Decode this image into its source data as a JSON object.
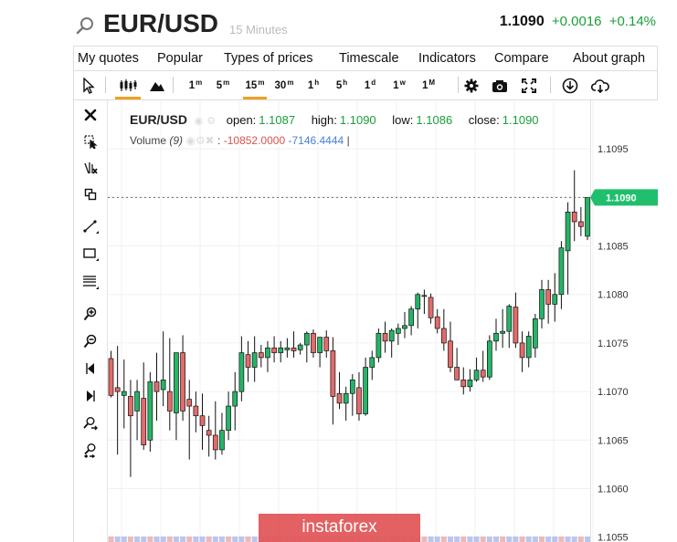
{
  "header": {
    "symbol": "EUR/USD",
    "interval": "15 Minutes",
    "last_price": "1.1090",
    "change": "+0.0016",
    "change_pct": "+0.14%"
  },
  "menu": [
    "My quotes",
    "Popular",
    "Types of prices",
    "Timescale",
    "Indicators",
    "Compare",
    "About graph"
  ],
  "timeframes": [
    {
      "base": "1",
      "sup": "m"
    },
    {
      "base": "5",
      "sup": "m"
    },
    {
      "base": "15",
      "sup": "m",
      "active": true
    },
    {
      "base": "30",
      "sup": "m"
    },
    {
      "base": "1",
      "sup": "h"
    },
    {
      "base": "5",
      "sup": "h"
    },
    {
      "base": "1",
      "sup": "d"
    },
    {
      "base": "1",
      "sup": "w"
    },
    {
      "base": "1",
      "sup": "M"
    }
  ],
  "toolbar_icons": [
    "cursor-icon",
    "candlestick-icon",
    "area-chart-icon",
    "gear-icon",
    "camera-icon",
    "fullscreen-icon",
    "download-icon",
    "cloud-download-icon"
  ],
  "left_tools": [
    "close-icon",
    "select-tool-icon",
    "delete-drawings-icon",
    "layers-icon",
    "trendline-icon",
    "rectangle-icon",
    "fib-levels-icon",
    "zoom-in-icon",
    "zoom-out-icon",
    "scroll-left-icon",
    "scroll-right-icon",
    "zoom-fit-icon",
    "zoom-reset-icon"
  ],
  "legend": {
    "symbol": "EUR/USD",
    "open_label": "open:",
    "open": "1.1087",
    "high_label": "high:",
    "high": "1.1090",
    "low_label": "low:",
    "low": "1.1086",
    "close_label": "close:",
    "close": "1.1090"
  },
  "volume_legend": {
    "label": "Volume",
    "period": "(9)",
    "value1": "-10852.0000",
    "value2": "-7146.4444",
    "sep": ":",
    "end": "|"
  },
  "colors": {
    "up": "#26b467",
    "down": "#e36b6b",
    "price_tag": "#1fbf6d"
  },
  "watermark": "instaforex",
  "chart_data": {
    "type": "candlestick",
    "price_tag": "1.1090",
    "yticks": [
      "1.1095",
      "1.1090",
      "1.1085",
      "1.1080",
      "1.1075",
      "1.1070",
      "1.1065",
      "1.1060",
      "1.1055"
    ],
    "ylim": [
      1.10545,
      1.11
    ],
    "candles": [
      [
        1.10734,
        1.10742,
        1.10694,
        1.10696
      ],
      [
        1.10704,
        1.10747,
        1.10635,
        1.107
      ],
      [
        1.10696,
        1.10733,
        1.10662,
        1.107
      ],
      [
        1.10695,
        1.10712,
        1.10612,
        1.10675
      ],
      [
        1.1068,
        1.10712,
        1.1065,
        1.107
      ],
      [
        1.10693,
        1.1073,
        1.1064,
        1.10645
      ],
      [
        1.1065,
        1.1072,
        1.10638,
        1.1071
      ],
      [
        1.1071,
        1.1074,
        1.1067,
        1.107
      ],
      [
        1.10702,
        1.10762,
        1.10685,
        1.10712
      ],
      [
        1.107,
        1.10755,
        1.1066,
        1.1068
      ],
      [
        1.10678,
        1.10715,
        1.1065,
        1.1074
      ],
      [
        1.1074,
        1.10758,
        1.1067,
        1.1068
      ],
      [
        1.10692,
        1.10712,
        1.1063,
        1.10685
      ],
      [
        1.10685,
        1.107,
        1.10658,
        1.10675
      ],
      [
        1.10675,
        1.10698,
        1.1064,
        1.10665
      ],
      [
        1.1066,
        1.10675,
        1.10633,
        1.10655
      ],
      [
        1.10655,
        1.1069,
        1.1063,
        1.1064
      ],
      [
        1.1064,
        1.10678,
        1.10635,
        1.1066
      ],
      [
        1.1066,
        1.107,
        1.1065,
        1.10685
      ],
      [
        1.10685,
        1.1072,
        1.1066,
        1.107
      ],
      [
        1.107,
        1.10757,
        1.1069,
        1.1074
      ],
      [
        1.10738,
        1.10752,
        1.1071,
        1.10725
      ],
      [
        1.10725,
        1.10757,
        1.1071,
        1.1074
      ],
      [
        1.1074,
        1.10748,
        1.10725,
        1.10735
      ],
      [
        1.10735,
        1.10752,
        1.1072,
        1.10745
      ],
      [
        1.10745,
        1.10757,
        1.1073,
        1.1074
      ],
      [
        1.1074,
        1.10752,
        1.1073,
        1.10745
      ],
      [
        1.10743,
        1.10755,
        1.10735,
        1.10745
      ],
      [
        1.10745,
        1.10762,
        1.10735,
        1.10742
      ],
      [
        1.10743,
        1.1075,
        1.10738,
        1.10748
      ],
      [
        1.10748,
        1.10762,
        1.1073,
        1.1076
      ],
      [
        1.1076,
        1.10764,
        1.10735,
        1.1074
      ],
      [
        1.1074,
        1.10756,
        1.10725,
        1.10756
      ],
      [
        1.10756,
        1.10763,
        1.10735,
        1.10742
      ],
      [
        1.10742,
        1.10756,
        1.10666,
        1.10695
      ],
      [
        1.10698,
        1.1072,
        1.10682,
        1.10688
      ],
      [
        1.10688,
        1.10705,
        1.1067,
        1.10698
      ],
      [
        1.10698,
        1.10718,
        1.10675,
        1.10712
      ],
      [
        1.10704,
        1.1072,
        1.1067,
        1.10677
      ],
      [
        1.10677,
        1.10735,
        1.10675,
        1.10725
      ],
      [
        1.10725,
        1.10742,
        1.10712,
        1.10735
      ],
      [
        1.10735,
        1.10765,
        1.1073,
        1.1076
      ],
      [
        1.1076,
        1.10772,
        1.1074,
        1.10752
      ],
      [
        1.10752,
        1.10765,
        1.10735,
        1.10763
      ],
      [
        1.1076,
        1.1077,
        1.10748,
        1.10765
      ],
      [
        1.10765,
        1.10782,
        1.10755,
        1.10768
      ],
      [
        1.10768,
        1.10788,
        1.10758,
        1.10785
      ],
      [
        1.10785,
        1.10802,
        1.10765,
        1.108
      ],
      [
        1.10799,
        1.10805,
        1.1078,
        1.10798
      ],
      [
        1.10797,
        1.10801,
        1.1077,
        1.10776
      ],
      [
        1.10777,
        1.10785,
        1.1076,
        1.10765
      ],
      [
        1.10765,
        1.10785,
        1.10742,
        1.1075
      ],
      [
        1.10752,
        1.10772,
        1.1072,
        1.10725
      ],
      [
        1.10725,
        1.10745,
        1.10712,
        1.10712
      ],
      [
        1.10712,
        1.10725,
        1.10697,
        1.10705
      ],
      [
        1.10705,
        1.10723,
        1.107,
        1.10712
      ],
      [
        1.10712,
        1.10735,
        1.1071,
        1.10722
      ],
      [
        1.10722,
        1.10742,
        1.1071,
        1.10715
      ],
      [
        1.10715,
        1.10758,
        1.10712,
        1.10752
      ],
      [
        1.10752,
        1.10775,
        1.10742,
        1.1076
      ],
      [
        1.1076,
        1.10785,
        1.10745,
        1.10762
      ],
      [
        1.10762,
        1.1079,
        1.10745,
        1.10788
      ],
      [
        1.10787,
        1.10802,
        1.10745,
        1.1075
      ],
      [
        1.1075,
        1.10762,
        1.1072,
        1.10735
      ],
      [
        1.10735,
        1.10762,
        1.10725,
        1.10757
      ],
      [
        1.10745,
        1.1078,
        1.10735,
        1.10775
      ],
      [
        1.10775,
        1.10815,
        1.10765,
        1.10805
      ],
      [
        1.10805,
        1.10815,
        1.1077,
        1.1079
      ],
      [
        1.1079,
        1.10822,
        1.10772,
        1.108
      ],
      [
        1.108,
        1.10855,
        1.10785,
        1.10848
      ],
      [
        1.10845,
        1.10895,
        1.108,
        1.10885
      ],
      [
        1.10885,
        1.10928,
        1.10855,
        1.10875
      ],
      [
        1.10875,
        1.1089,
        1.1086,
        1.1087
      ],
      [
        1.1086,
        1.109,
        1.10856,
        1.109
      ]
    ]
  }
}
